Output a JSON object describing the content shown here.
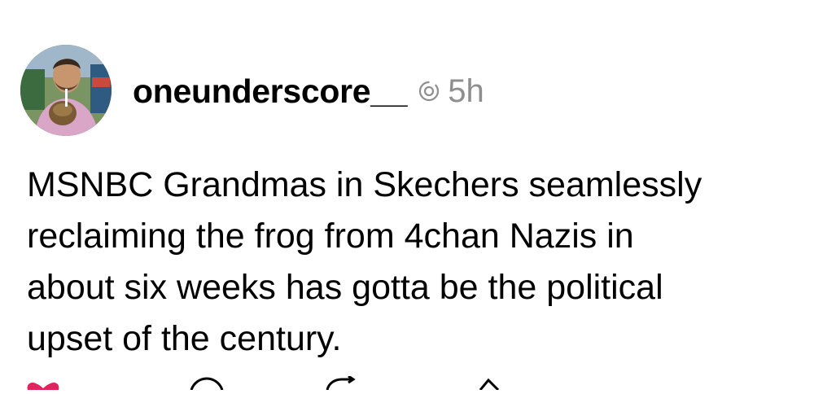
{
  "post": {
    "username": "oneunderscore__",
    "timestamp": "5h",
    "text_lines": [
      "MSNBC Grandmas in Skechers seamlessly",
      "reclaiming the frog from 4chan Nazis in",
      "about six weeks has gotta be the political",
      "upset of the century."
    ]
  },
  "icons": {
    "avatar": "avatar",
    "status": "threads-icon",
    "like": "heart-icon",
    "reply": "comment-icon",
    "repost": "repost-icon",
    "share": "share-icon"
  },
  "colors": {
    "text": "#000000",
    "secondary": "#8e8e8e",
    "like": "#e0245e"
  }
}
